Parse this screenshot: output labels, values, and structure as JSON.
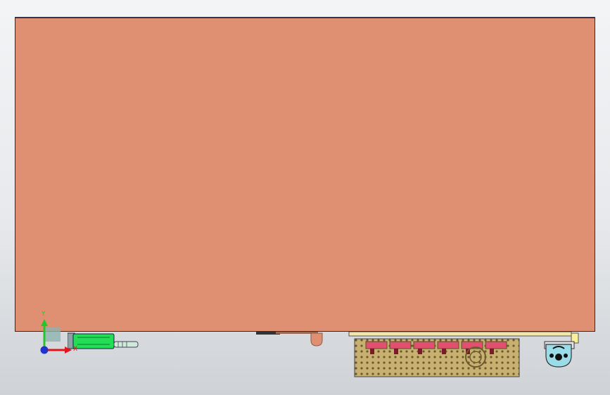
{
  "viewport": {
    "background_top": "#f3f4f6",
    "background_bottom": "#cfd2d6"
  },
  "part": {
    "face_color": "#e09072",
    "edge_color": "#2b2b3a"
  },
  "triad": {
    "x_label": "X",
    "y_label": "Y",
    "x_color": "#e0161c",
    "y_color": "#29c42a",
    "z_color": "#2233cc"
  },
  "components": {
    "connector_color": "#22dd55",
    "pcb_color": "#c8b070",
    "pcb_hole_color": "#6b5a30",
    "led_color": "#e05070",
    "fan_color": "#9adde8"
  }
}
